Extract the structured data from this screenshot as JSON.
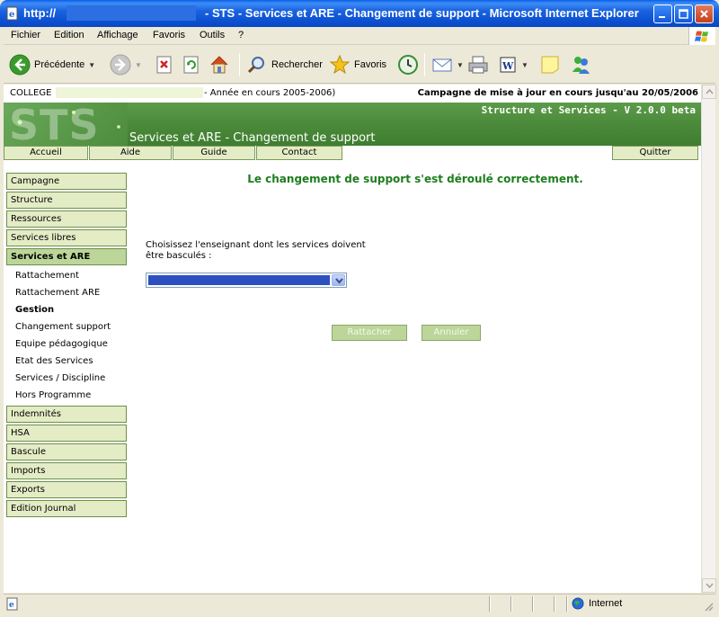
{
  "window": {
    "title_prefix": "http://",
    "title_main": "- STS - Services et ARE - Changement de support - Microsoft Internet Explorer"
  },
  "menubar": {
    "items": [
      "Fichier",
      "Edition",
      "Affichage",
      "Favoris",
      "Outils",
      "?"
    ]
  },
  "toolbar": {
    "back_label": "Précédente",
    "search_label": "Rechercher",
    "favorites_label": "Favoris"
  },
  "header": {
    "college_label": "COLLEGE",
    "year_text": "- Année en cours 2005-2006)",
    "campaign_text": "Campagne de mise à jour en cours jusqu'au 20/05/2006",
    "version": "Structure et Services - V 2.0.0 beta",
    "logo": "STS",
    "subtitle": "Services et ARE - Changement de support"
  },
  "nav": {
    "tabs": [
      "Accueil",
      "Aide",
      "Guide",
      "Contact"
    ],
    "quit": "Quitter"
  },
  "sidebar": {
    "top_items": [
      "Campagne",
      "Structure",
      "Ressources",
      "Services libres"
    ],
    "active_item": "Services et ARE",
    "sub_items": [
      "Rattachement",
      "Rattachement ARE",
      "Gestion",
      "Changement support",
      "Equipe pédagogique",
      "Etat des Services",
      "Services / Discipline",
      "Hors Programme"
    ],
    "bottom_items": [
      "Indemnités",
      "HSA",
      "Bascule",
      "Imports",
      "Exports",
      "Edition Journal"
    ]
  },
  "main": {
    "message": "Le changement de support s'est déroulé correctement.",
    "prompt": "Choisissez l'enseignant dont les services doivent être basculés :",
    "attach_button": "Rattacher",
    "cancel_button": "Annuler"
  },
  "statusbar": {
    "zone": "Internet"
  },
  "colors": {
    "banner_green": "#4b8a3a",
    "tab_fill": "#e4ecc6",
    "active_fill": "#bcd69a",
    "message_green": "#1e7d1e"
  }
}
